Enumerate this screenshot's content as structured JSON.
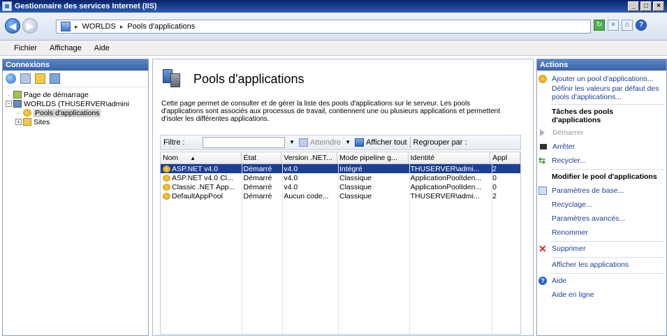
{
  "window": {
    "title": "Gestionnaire des services Internet (IIS)",
    "controls": [
      "_",
      "□",
      "×"
    ]
  },
  "address": {
    "crumbs": [
      "WORLDS",
      "Pools d'applications"
    ],
    "separator": "▸"
  },
  "menu": [
    "Fichier",
    "Affichage",
    "Aide"
  ],
  "connections": {
    "title": "Connexions",
    "tree": [
      {
        "label": "Page de démarrage",
        "icon": "start-page-icon",
        "indent": 0,
        "expander": "-",
        "selected": false
      },
      {
        "label": "WORLDS (THUSERVER\\admini",
        "icon": "server-icon",
        "indent": 0,
        "expander": "⊟",
        "selected": false
      },
      {
        "label": "Pools d'applications",
        "icon": "app-pool-icon",
        "indent": 1,
        "expander": "-",
        "selected": true
      },
      {
        "label": "Sites",
        "icon": "sites-folder-icon",
        "indent": 1,
        "expander": "⊞",
        "selected": false
      }
    ]
  },
  "main": {
    "title": "Pools d'applications",
    "description": "Cette page permet de consulter et de gérer la liste des pools d'applications sur le serveur. Les pools d'applications sont associés aux processus de travail, contiennent une ou plusieurs applications et permettent d'isoler les différentes applications.",
    "filter": {
      "label": "Filtre :",
      "go_label": "Atteindre",
      "show_all_label": "Afficher tout",
      "group_by_label": "Regrouper par :"
    },
    "columns": [
      "Nom",
      "État",
      "Version .NET...",
      "Mode pipeline g...",
      "Identité",
      "Appl"
    ],
    "rows": [
      {
        "name": "ASP.NET v4.0",
        "status": "Démarré",
        "version": "v4.0",
        "mode": "Intégré",
        "identity": "THUSERVER\\admi...",
        "apps": "2",
        "selected": true
      },
      {
        "name": "ASP.NET v4.0 Cl...",
        "status": "Démarré",
        "version": "v4.0",
        "mode": "Classique",
        "identity": "ApplicationPoolIden...",
        "apps": "0",
        "selected": false
      },
      {
        "name": "Classic .NET App...",
        "status": "Démarré",
        "version": "v4.0",
        "mode": "Classique",
        "identity": "ApplicationPoolIden...",
        "apps": "0",
        "selected": false
      },
      {
        "name": "DefaultAppPool",
        "status": "Démarré",
        "version": "Aucun code...",
        "mode": "Classique",
        "identity": "THUSERVER\\admi...",
        "apps": "2",
        "selected": false
      }
    ]
  },
  "actions": {
    "title": "Actions",
    "items": [
      {
        "label": "Ajouter un pool d'applications...",
        "icon": "add-pool-icon",
        "kind": "link"
      },
      {
        "label": "Définir les valeurs par défaut des pools d'applications...",
        "icon": "",
        "kind": "link"
      },
      {
        "label": "Tâches des pools d'applications",
        "icon": "",
        "kind": "head"
      },
      {
        "label": "Démarrer",
        "icon": "start-icon",
        "kind": "disabled"
      },
      {
        "label": "Arrêter",
        "icon": "stop-icon",
        "kind": "link"
      },
      {
        "label": "Recycler...",
        "icon": "recycle-icon",
        "kind": "link"
      },
      {
        "label": "Modifier le pool d'applications",
        "icon": "",
        "kind": "head"
      },
      {
        "label": "Paramètres de base...",
        "icon": "basic-settings-icon",
        "kind": "link"
      },
      {
        "label": "Recyclage...",
        "icon": "",
        "kind": "link"
      },
      {
        "label": "Paramètres avancés...",
        "icon": "",
        "kind": "link"
      },
      {
        "label": "Renommer",
        "icon": "",
        "kind": "link"
      },
      {
        "label": "Supprimer",
        "icon": "delete-icon",
        "kind": "link"
      },
      {
        "label": "Afficher les applications",
        "icon": "",
        "kind": "link"
      },
      {
        "label": "Aide",
        "icon": "help-icon",
        "kind": "link"
      },
      {
        "label": "Aide en ligne",
        "icon": "",
        "kind": "link"
      }
    ]
  }
}
